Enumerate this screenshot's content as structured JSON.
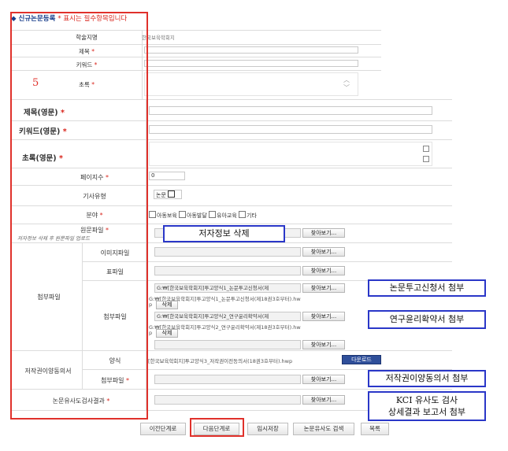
{
  "form": {
    "title": "◆ 신규논문등록",
    "required_note": "* 표시는 필수항목입니다",
    "annotation_number": "5",
    "fields": {
      "society_name": {
        "label": "학술지명",
        "value": "한국보육학회지"
      },
      "title": {
        "label": "제목",
        "star": "*"
      },
      "keyword": {
        "label": "키워드",
        "star": "*"
      },
      "abstract": {
        "label": "초록",
        "star": "*"
      },
      "title_en": {
        "label": "제목(영문)",
        "star": "*"
      },
      "keyword_en": {
        "label": "키워드(영문)",
        "star": "*"
      },
      "abstract_en": {
        "label": "초록(영문)",
        "star": "*"
      },
      "pages": {
        "label": "페이지수",
        "star": "*",
        "value": "0"
      },
      "article_type": {
        "label": "기사유형",
        "value": "논문"
      },
      "field": {
        "label": "분야",
        "star": "*",
        "options": [
          "아동보육",
          "아동발달",
          "유아교육",
          "기타"
        ]
      },
      "original_file": {
        "label": "원문파일",
        "star": "*",
        "note": "저자정보 삭제 후 원문파일 업로드",
        "browse": "찾아보기..."
      },
      "attachments": {
        "label": "첨부파일",
        "image": {
          "label": "이미지파일",
          "browse": "찾아보기..."
        },
        "table": {
          "label": "표파일",
          "browse": "찾아보기..."
        },
        "files": {
          "label": "첨부파일",
          "file1_input": "G:₩[한국보육학회지]투고양식1_논문투고신청서(제",
          "file1_path_a": "G:₩[한국보육학회지]투고양식1_논문투고신청서(제18권3호부터).hw",
          "file1_path_b": "p",
          "file2_input": "G:₩[한국보육학회지]투고양식2_연구윤리확약서(제",
          "file2_path_a": "G:₩[한국보육학회지]투고양식2_연구윤리확약서(제18권3호부터).hw",
          "file2_path_b": "p",
          "browse": "찾아보기...",
          "delete": "삭제"
        }
      },
      "copyright": {
        "label": "저작권이양동의서",
        "form": {
          "label": "양식",
          "value": "[한국보육학회지]투고양식3_저작권이전동의서(18권3호부터).hwp",
          "download": "다운로드"
        },
        "attach": {
          "label": "첨부파일",
          "star": "*",
          "browse": "찾아보기..."
        }
      },
      "similarity": {
        "label": "논문유사도검사결과",
        "star": "*",
        "browse": "찾아보기..."
      }
    }
  },
  "callouts": {
    "delete_author": "저자정보 삭제",
    "application": "논문투고신청서 첨부",
    "ethics": "연구윤리확약서 첨부",
    "copyright": "저작권이양동의서 첨부",
    "kci_line1": "KCI 유사도 검사",
    "kci_line2": "상세결과 보고서 첨부"
  },
  "buttons": {
    "prev": "이전단계로",
    "next": "다음단계로",
    "temp_save": "임시저장",
    "similarity_search": "논문유사도 검색",
    "list": "목록"
  },
  "colors": {
    "annotation_red": "#e0312b",
    "callout_blue": "#2a37c8",
    "title_blue": "#1a3e8c"
  }
}
